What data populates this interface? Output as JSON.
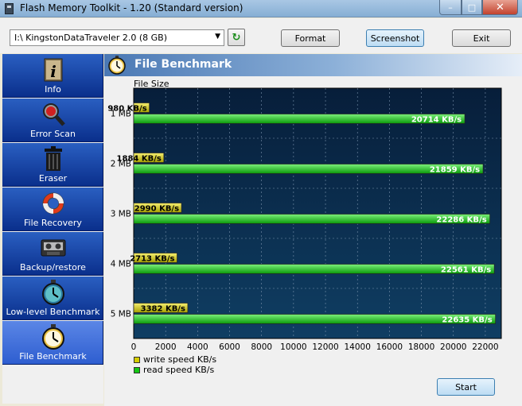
{
  "window": {
    "title": "Flash Memory Toolkit - 1.20 (Standard version)"
  },
  "toolbar": {
    "drive_value": "I:\\ KingstonDataTraveler 2.0 (8 GB)",
    "format_label": "Format",
    "screenshot_label": "Screenshot",
    "exit_label": "Exit"
  },
  "sidebar": {
    "items": [
      {
        "label": "Info",
        "icon": "info-icon"
      },
      {
        "label": "Error Scan",
        "icon": "magnifier-icon"
      },
      {
        "label": "Eraser",
        "icon": "trash-icon"
      },
      {
        "label": "File Recovery",
        "icon": "lifebuoy-icon"
      },
      {
        "label": "Backup/restore",
        "icon": "tape-icon"
      },
      {
        "label": "Low-level Benchmark",
        "icon": "stopwatch-icon"
      },
      {
        "label": "File Benchmark",
        "icon": "stopwatch-icon"
      }
    ],
    "selected_index": 6
  },
  "panel": {
    "title": "File Benchmark",
    "file_size_label": "File Size"
  },
  "chart_data": {
    "type": "bar",
    "orientation": "horizontal",
    "categories": [
      "1 MB",
      "2 MB",
      "3 MB",
      "4 MB",
      "5 MB"
    ],
    "series": [
      {
        "name": "write speed KB/s",
        "color": "#d4cc00",
        "values": [
          980,
          1884,
          2990,
          2713,
          3382
        ],
        "labels": [
          "980 KB/s",
          "1884 KB/s",
          "2990 KB/s",
          "2713 KB/s",
          "3382 KB/s"
        ]
      },
      {
        "name": "read speed KB/s",
        "color": "#14c814",
        "values": [
          20714,
          21859,
          22286,
          22561,
          22635
        ],
        "labels": [
          "20714 KB/s",
          "21859 KB/s",
          "22286 KB/s",
          "22561 KB/s",
          "22635 KB/s"
        ]
      }
    ],
    "xlim": [
      0,
      23000
    ],
    "xticks": [
      "0",
      "2000",
      "4000",
      "6000",
      "8000",
      "10000",
      "12000",
      "14000",
      "16000",
      "18000",
      "20000",
      "22000"
    ],
    "grid": true,
    "legend_position": "bottom-left",
    "background": "#0b2d4f"
  },
  "start_label": "Start"
}
